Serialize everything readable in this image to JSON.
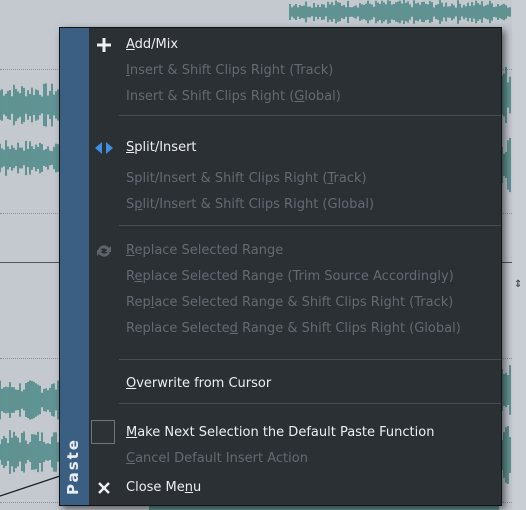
{
  "menu": {
    "side_title": "Paste",
    "items": [
      {
        "pre": "",
        "key": "A",
        "post": "dd/Mix",
        "enabled": true,
        "icon": "plus-icon"
      },
      {
        "pre": "",
        "key": "I",
        "post": "nsert & Shift Clips Right (Track)",
        "enabled": false,
        "icon": ""
      },
      {
        "pre": "Insert & Shift Clips Right (",
        "key": "G",
        "post": "lobal)",
        "enabled": false,
        "icon": ""
      },
      {
        "pre": "",
        "key": "S",
        "post": "plit/Insert",
        "enabled": true,
        "icon": "split-insert-icon"
      },
      {
        "pre": "Split/Insert & Shift Clips Right (",
        "key": "T",
        "post": "rack)",
        "enabled": false,
        "icon": ""
      },
      {
        "pre": "S",
        "key": "p",
        "post": "lit/Insert & Shift Clips Right (Global)",
        "enabled": false,
        "icon": ""
      },
      {
        "pre": "",
        "key": "R",
        "post": "eplace Selected Range",
        "enabled": false,
        "icon": "replace-icon"
      },
      {
        "pre": "R",
        "key": "e",
        "post": "place Selected Range (Trim Source Accordingly)",
        "enabled": false,
        "icon": ""
      },
      {
        "pre": "Rep",
        "key": "l",
        "post": "ace Selected Range & Shift Clips Right (Track)",
        "enabled": false,
        "icon": ""
      },
      {
        "pre": "Replace Selecte",
        "key": "d",
        "post": " Range & Shift Clips Right (Global)",
        "enabled": false,
        "icon": ""
      },
      {
        "pre": "",
        "key": "O",
        "post": "verwrite from Cursor",
        "enabled": true,
        "icon": ""
      },
      {
        "pre": "",
        "key": "M",
        "post": "ake Next Selection the Default Paste Function",
        "enabled": true,
        "icon": "checkbox"
      },
      {
        "pre": "",
        "key": "C",
        "post": "ancel Default Insert Action",
        "enabled": false,
        "icon": ""
      },
      {
        "pre": "Close Me",
        "key": "n",
        "post": "u",
        "enabled": true,
        "icon": "close-icon"
      }
    ]
  },
  "colors": {
    "menu_bg": "#2b3035",
    "side_strip": "#3b5f83",
    "text_enabled": "#eceff2",
    "text_disabled": "#636a72",
    "accent_icon": "#3f8fe0",
    "waveform": "#1f6f6b"
  }
}
